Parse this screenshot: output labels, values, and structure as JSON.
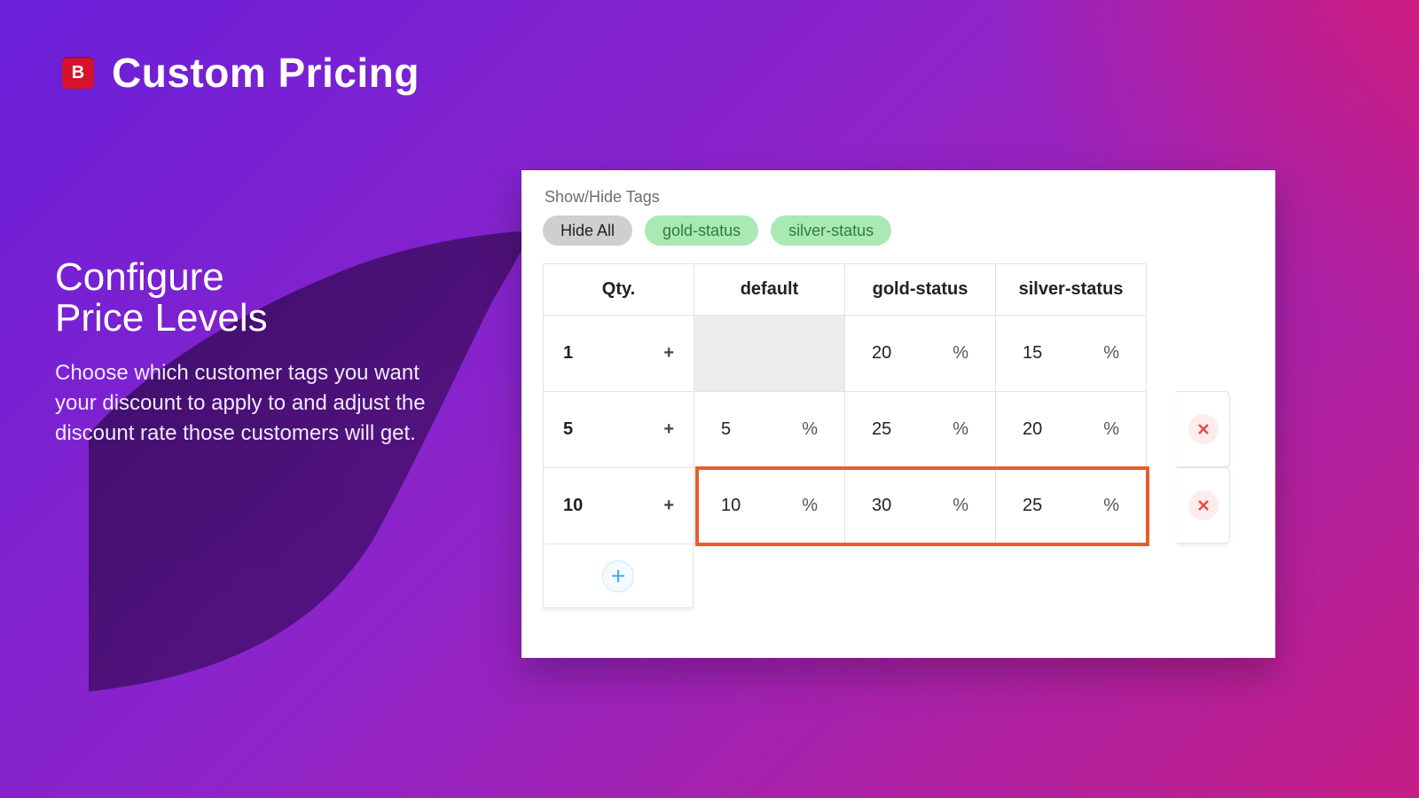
{
  "brand": {
    "logo_letter": "B",
    "title": "Custom Pricing"
  },
  "copy": {
    "heading_line1": "Configure",
    "heading_line2": "Price Levels",
    "body": "Choose which customer tags you want your discount to apply to and adjust the discount rate those customers will get."
  },
  "panel": {
    "section_label": "Show/Hide Tags",
    "pills": {
      "hide_all": "Hide All",
      "gold": "gold-status",
      "silver": "silver-status"
    }
  },
  "table": {
    "headers": {
      "qty": "Qty.",
      "default": "default",
      "gold": "gold-status",
      "silver": "silver-status"
    },
    "unit": "%",
    "qty_suffix": "+",
    "rows": [
      {
        "qty": "1",
        "default": "",
        "gold": "20",
        "silver": "15",
        "deletable": false,
        "default_blank": true
      },
      {
        "qty": "5",
        "default": "5",
        "gold": "25",
        "silver": "20",
        "deletable": true,
        "default_blank": false
      },
      {
        "qty": "10",
        "default": "10",
        "gold": "30",
        "silver": "25",
        "deletable": true,
        "default_blank": false
      }
    ],
    "highlight_row_index": 2
  },
  "chart_data": {
    "type": "table",
    "title": "Quantity-based discount tiers by customer tag",
    "columns": [
      "Qty.",
      "default",
      "gold-status",
      "silver-status"
    ],
    "unit": "%",
    "rows": [
      {
        "qty": 1,
        "default": null,
        "gold-status": 20,
        "silver-status": 15
      },
      {
        "qty": 5,
        "default": 5,
        "gold-status": 25,
        "silver-status": 20
      },
      {
        "qty": 10,
        "default": 10,
        "gold-status": 30,
        "silver-status": 25
      }
    ]
  }
}
